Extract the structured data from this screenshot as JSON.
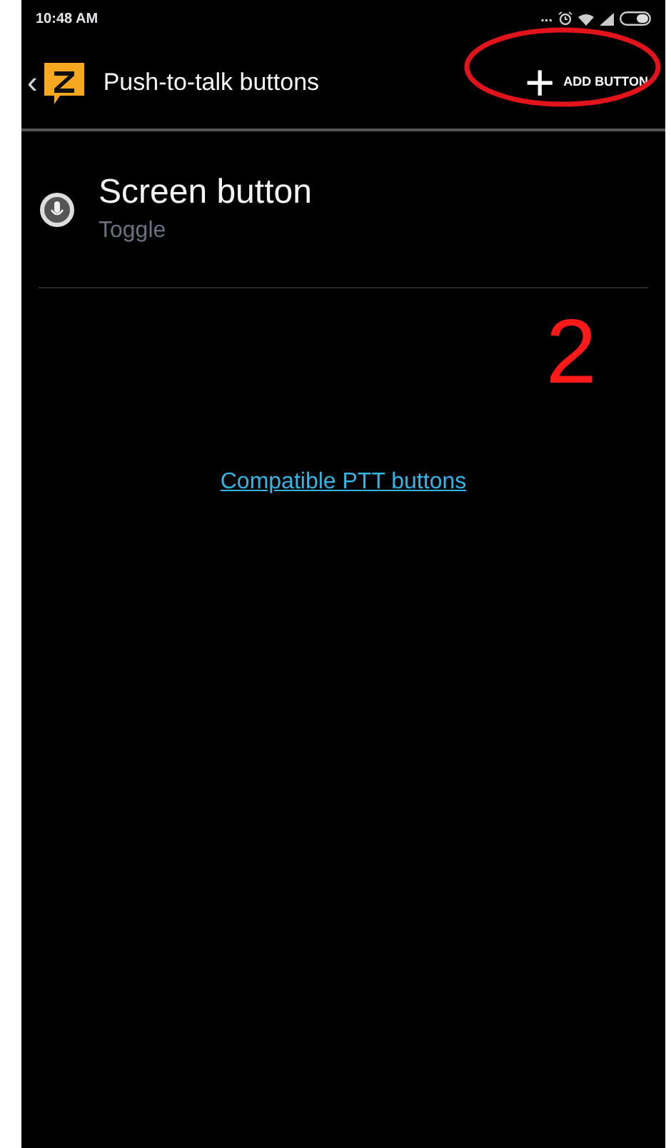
{
  "status_bar": {
    "time": "10:48 AM",
    "dots": "..."
  },
  "toolbar": {
    "back": "‹",
    "title": "Push-to-talk buttons",
    "action": {
      "icon": "+",
      "label": "ADD BUTTON",
      "circled": true
    }
  },
  "items": [
    {
      "title": "Screen button",
      "subtitle": "Toggle"
    }
  ],
  "annotation": {
    "label": "2"
  },
  "link": "Compatible PTT buttons"
}
